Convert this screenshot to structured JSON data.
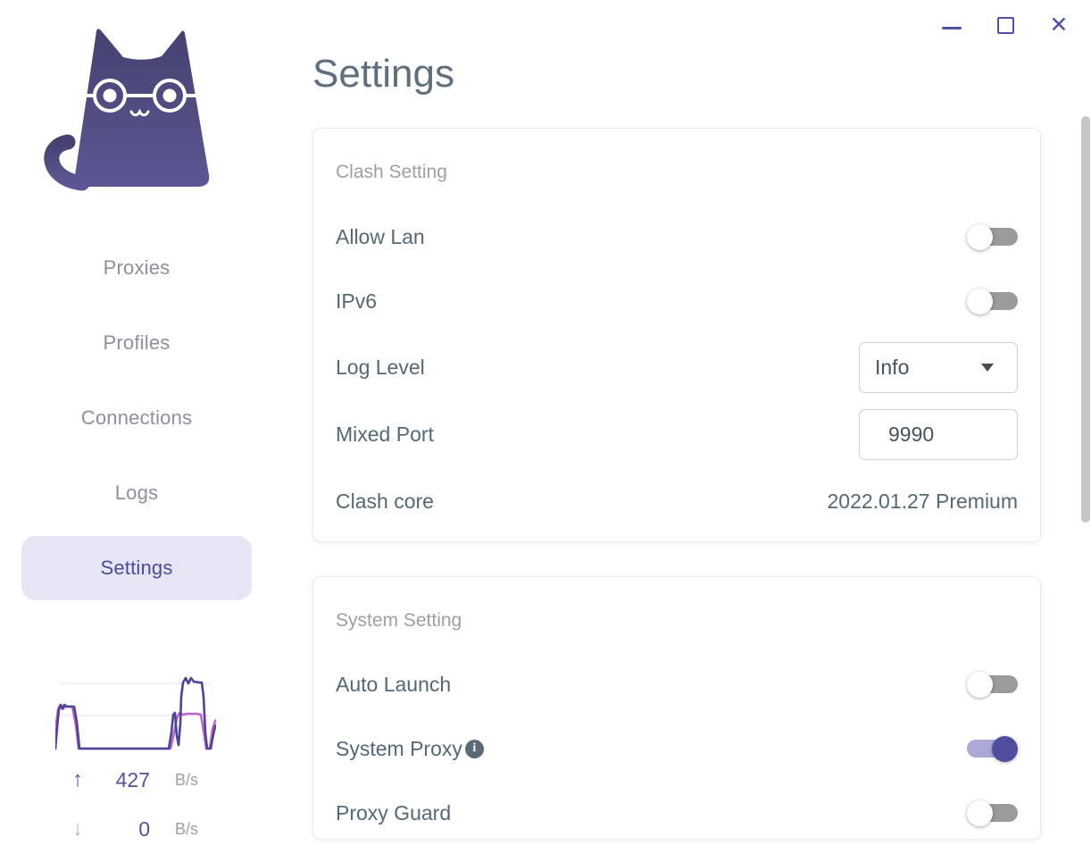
{
  "window": {
    "controls": [
      {
        "name": "minimize"
      },
      {
        "name": "maximize"
      },
      {
        "name": "close",
        "glyph": "✕"
      }
    ]
  },
  "sidebar": {
    "nav": [
      {
        "label": "Proxies",
        "active": false
      },
      {
        "label": "Profiles",
        "active": false
      },
      {
        "label": "Connections",
        "active": false
      },
      {
        "label": "Logs",
        "active": false
      },
      {
        "label": "Settings",
        "active": true
      }
    ],
    "traffic": {
      "upload": {
        "arrow": "↑",
        "value": "427",
        "unit": "B/s"
      },
      "download": {
        "arrow": "↓",
        "value": "0",
        "unit": "B/s"
      },
      "chart": {
        "type": "line",
        "description": "realtime traffic sparkline, two bursts separated by idle flat baseline",
        "gridlines": 2,
        "series": [
          {
            "name": "download",
            "color": "#c065c8"
          },
          {
            "name": "upload",
            "color": "#4b4595"
          }
        ]
      }
    }
  },
  "page": {
    "title": "Settings"
  },
  "cards": [
    {
      "header": "Clash Setting",
      "rows": [
        {
          "label": "Allow Lan",
          "type": "toggle",
          "state": "off"
        },
        {
          "label": "IPv6",
          "type": "toggle",
          "state": "off"
        },
        {
          "label": "Log Level",
          "type": "select",
          "value": "Info"
        },
        {
          "label": "Mixed Port",
          "type": "input",
          "value": "9990"
        },
        {
          "label": "Clash core",
          "type": "text",
          "value": "2022.01.27 Premium"
        }
      ]
    },
    {
      "header": "System Setting",
      "rows": [
        {
          "label": "Auto Launch",
          "type": "toggle",
          "state": "off"
        },
        {
          "label": "System Proxy",
          "type": "toggle",
          "state": "on",
          "info": true
        },
        {
          "label": "Proxy Guard",
          "type": "toggle",
          "state": "off"
        }
      ]
    }
  ],
  "icons": {
    "info": "i"
  },
  "colors": {
    "accent": "#514d9e",
    "nav_active_bg": "#e6e5f4",
    "nav_active_text": "#4b4a9f",
    "nav_text": "#8b909f",
    "label_text": "#546877",
    "header_text": "#9aa0a7",
    "title_text": "#5f6f7e",
    "toggle_off_track": "#9b9b9b",
    "toggle_on_track": "#abaad6",
    "window_controls": "#4f51a8"
  }
}
